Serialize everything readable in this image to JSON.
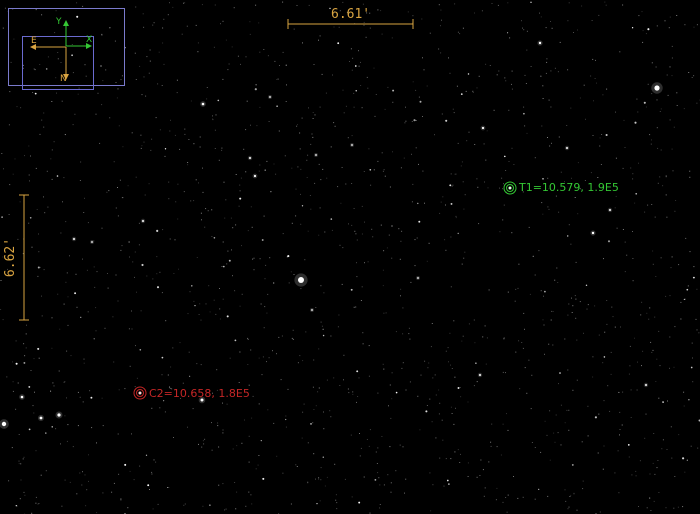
{
  "colors": {
    "target": "#34c734",
    "comparison": "#c42626",
    "scale": "#d9a441",
    "orientation_frame": "#7a7acc",
    "axis_y": "#34c734",
    "axis_x": "#34c734",
    "axis_e": "#d9a441",
    "axis_n": "#d9a441"
  },
  "scale_bars": {
    "horizontal_label": "6.61'",
    "vertical_label": "6.62'"
  },
  "orientation": {
    "y_label": "Y",
    "x_label": "X",
    "e_label": "E",
    "n_label": "N"
  },
  "apertures": {
    "target": {
      "label": "T1=10.579, 1.9E5"
    },
    "comparison": {
      "label": "C2=10.658, 1.8E5"
    }
  }
}
